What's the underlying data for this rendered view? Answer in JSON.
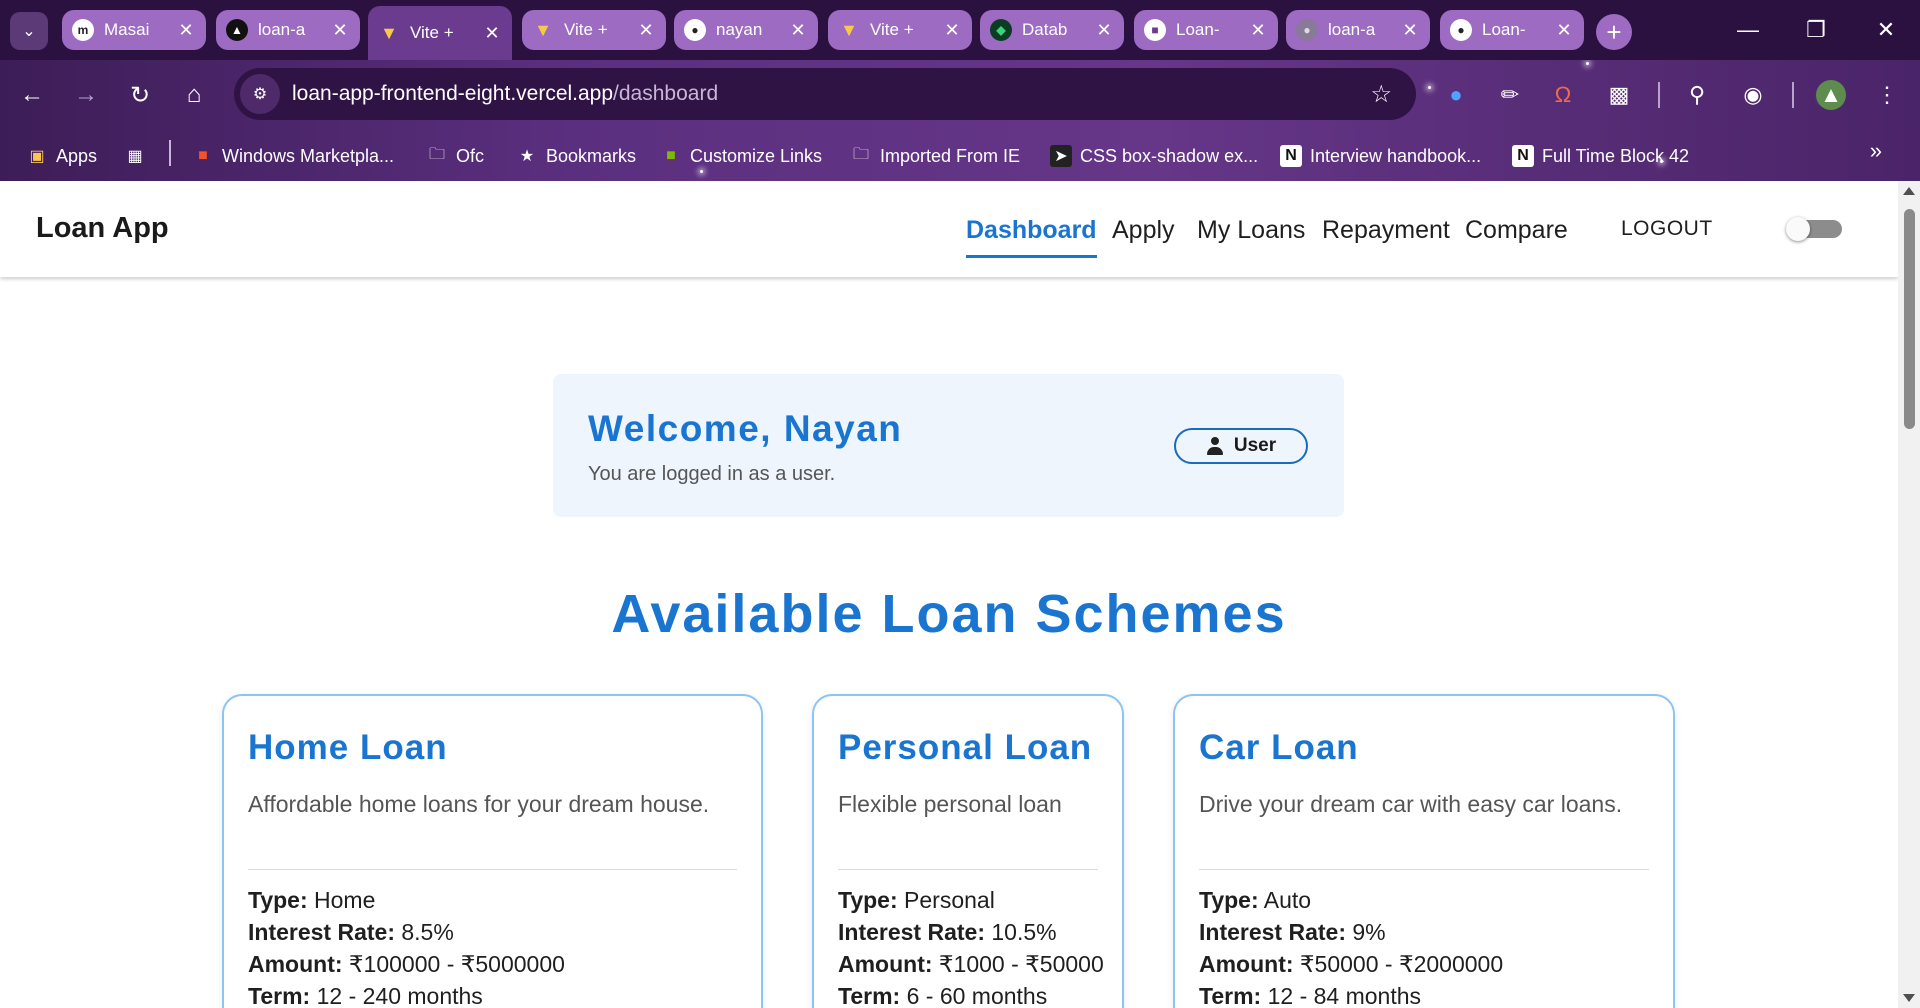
{
  "browser": {
    "tabs": [
      {
        "title": "Masai",
        "favicon": "masai-icon"
      },
      {
        "title": "loan-a",
        "favicon": "vercel-icon"
      },
      {
        "title": "Vite +",
        "favicon": "vite-icon",
        "active": true
      },
      {
        "title": "Vite +",
        "favicon": "vite-icon"
      },
      {
        "title": "nayan",
        "favicon": "github-icon"
      },
      {
        "title": "Vite +",
        "favicon": "vite-icon"
      },
      {
        "title": "Datab",
        "favicon": "mongodb-icon"
      },
      {
        "title": "Loan-",
        "favicon": "render-icon"
      },
      {
        "title": "loan-a",
        "favicon": "globe-icon"
      },
      {
        "title": "Loan-",
        "favicon": "github-icon"
      }
    ],
    "url_host": "loan-app-frontend-eight.vercel.app",
    "url_path": "/dashboard",
    "bookmarks": [
      "Apps",
      "Windows Marketpla...",
      "Ofc",
      "Bookmarks",
      "Customize Links",
      "Imported From IE",
      "CSS box-shadow ex...",
      "Interview handbook...",
      "Full Time Block 42"
    ]
  },
  "app": {
    "brand": "Loan App",
    "nav": [
      "Dashboard",
      "Apply",
      "My Loans",
      "Repayment",
      "Compare"
    ],
    "active_nav": "Dashboard",
    "logout": "LOGOUT",
    "theme_toggle_on": false
  },
  "welcome": {
    "heading": "Welcome, Nayan",
    "subtext": "You are logged in as a user.",
    "role": "User"
  },
  "schemes_title": "Available Loan Schemes",
  "schemes": [
    {
      "name": "Home Loan",
      "description": "Affordable home loans for your dream house.",
      "type_label": "Type:",
      "type": "Home",
      "rate_label": "Interest Rate:",
      "rate": "8.5%",
      "amount_label": "Amount:",
      "amount": "₹100000 - ₹5000000",
      "term_label": "Term:",
      "term": "12 - 240 months"
    },
    {
      "name": "Personal Loan",
      "description": "Flexible personal loan",
      "type_label": "Type:",
      "type": "Personal",
      "rate_label": "Interest Rate:",
      "rate": "10.5%",
      "amount_label": "Amount:",
      "amount": "₹1000 - ₹50000",
      "term_label": "Term:",
      "term": "6 - 60 months"
    },
    {
      "name": "Car Loan",
      "description": "Drive your dream car with easy car loans.",
      "type_label": "Type:",
      "type": "Auto",
      "rate_label": "Interest Rate:",
      "rate": "9%",
      "amount_label": "Amount:",
      "amount": "₹50000 - ₹2000000",
      "term_label": "Term:",
      "term": "12 - 84 months"
    }
  ],
  "colors": {
    "accent": "#1a75d1",
    "chrome": "#5b2f7f"
  }
}
